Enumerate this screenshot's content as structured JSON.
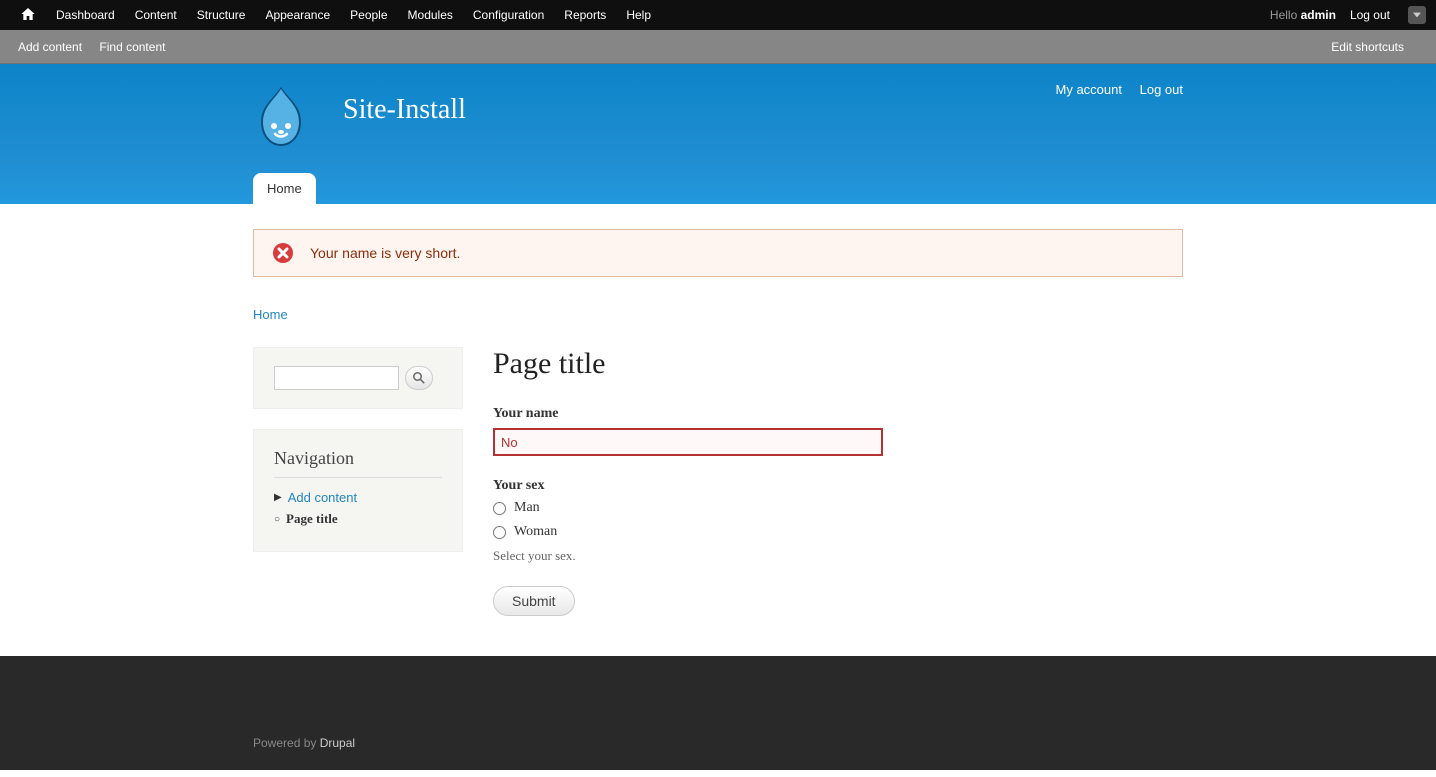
{
  "admin_menu": {
    "items": [
      "Dashboard",
      "Content",
      "Structure",
      "Appearance",
      "People",
      "Modules",
      "Configuration",
      "Reports",
      "Help"
    ],
    "hello_prefix": "Hello ",
    "username": "admin",
    "logout": "Log out"
  },
  "shortcuts": {
    "items": [
      "Add content",
      "Find content"
    ],
    "edit": "Edit shortcuts"
  },
  "header": {
    "site_name": "Site-Install",
    "user_links": [
      "My account",
      "Log out"
    ],
    "main_tab": "Home"
  },
  "error": {
    "message": "Your name is very short."
  },
  "breadcrumb": {
    "home": "Home"
  },
  "navigation": {
    "title": "Navigation",
    "items": [
      {
        "label": "Add content",
        "link": true,
        "expandable": true
      },
      {
        "label": "Page title",
        "link": false,
        "expandable": false
      }
    ]
  },
  "main": {
    "title": "Page title",
    "name_label": "Your name",
    "name_value": "No",
    "sex_label": "Your sex",
    "sex_options": [
      "Man",
      "Woman"
    ],
    "sex_help": "Select your sex.",
    "submit": "Submit"
  },
  "footer": {
    "powered_prefix": "Powered by ",
    "powered_link": "Drupal"
  }
}
